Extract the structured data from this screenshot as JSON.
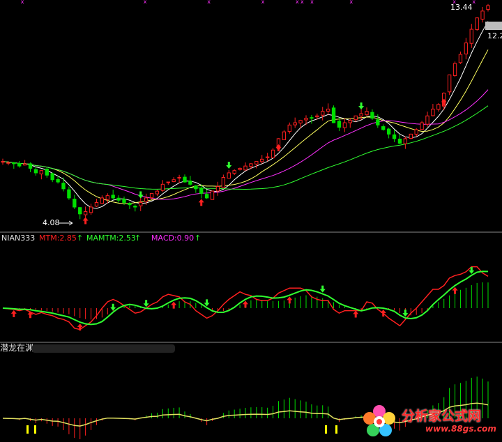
{
  "top_panel": {
    "price_high_label": "13.44",
    "price_right_label": "12.2",
    "price_low_label": "4.08"
  },
  "middle_panel": {
    "indicator_name": "NIAN333",
    "mtm_label": "MTM:2.85",
    "mamtm_label": "MAMTM:2.53",
    "macd_label": "MACD:0.90",
    "arrow_glyph": "↑"
  },
  "bottom_panel": {
    "indicator_name": "潜龙在渊"
  },
  "watermark": {
    "text": "分析家公式网",
    "url": "www.88gs.com"
  },
  "colors": {
    "background": "#000000",
    "divider": "#8a8a8a",
    "up_candle": "#ff2020",
    "down_candle": "#00e000",
    "ma_white": "#ffffff",
    "ma_yellow": "#ffff60",
    "ma_magenta": "#ff30ff",
    "ma_green": "#30ff30",
    "mtm": "#ff2020",
    "mamtm": "#30ff30",
    "macd": "#ff30ff",
    "signal_up_arrow": "#ff2020",
    "signal_down_arrow": "#30ff30",
    "marker": "#ff30ff"
  },
  "chart_data": {
    "type": "candlestick",
    "title": "",
    "y_range": [
      4.08,
      13.44
    ],
    "closes": [
      6.6,
      6.55,
      6.5,
      6.4,
      6.5,
      6.3,
      6.1,
      6.2,
      6.0,
      5.8,
      5.7,
      5.4,
      5.0,
      4.6,
      4.3,
      4.4,
      4.6,
      4.8,
      5.0,
      5.1,
      5.0,
      4.9,
      4.8,
      4.7,
      4.6,
      4.8,
      5.0,
      5.2,
      5.3,
      5.6,
      5.7,
      5.8,
      5.9,
      5.7,
      5.6,
      5.4,
      5.2,
      5.0,
      5.3,
      5.5,
      5.9,
      6.1,
      6.2,
      6.3,
      6.4,
      6.5,
      6.6,
      6.7,
      6.8,
      7.1,
      7.6,
      7.9,
      8.2,
      8.3,
      8.4,
      8.5,
      8.5,
      8.6,
      8.8,
      8.9,
      8.3,
      8.1,
      8.3,
      8.4,
      8.6,
      8.7,
      8.8,
      8.5,
      8.2,
      8.0,
      7.8,
      7.6,
      7.4,
      7.6,
      7.8,
      8.0,
      8.3,
      8.6,
      8.9,
      9.1,
      9.6,
      10.4,
      10.9,
      11.3,
      11.8,
      12.4,
      12.9,
      13.2,
      13.44
    ],
    "moving_averages": [
      "white",
      "yellow",
      "magenta",
      "green"
    ],
    "indicators": [
      {
        "name": "MTM",
        "value": 2.85
      },
      {
        "name": "MAMTM",
        "value": 2.53
      },
      {
        "name": "MACD",
        "value": 0.9
      }
    ]
  }
}
